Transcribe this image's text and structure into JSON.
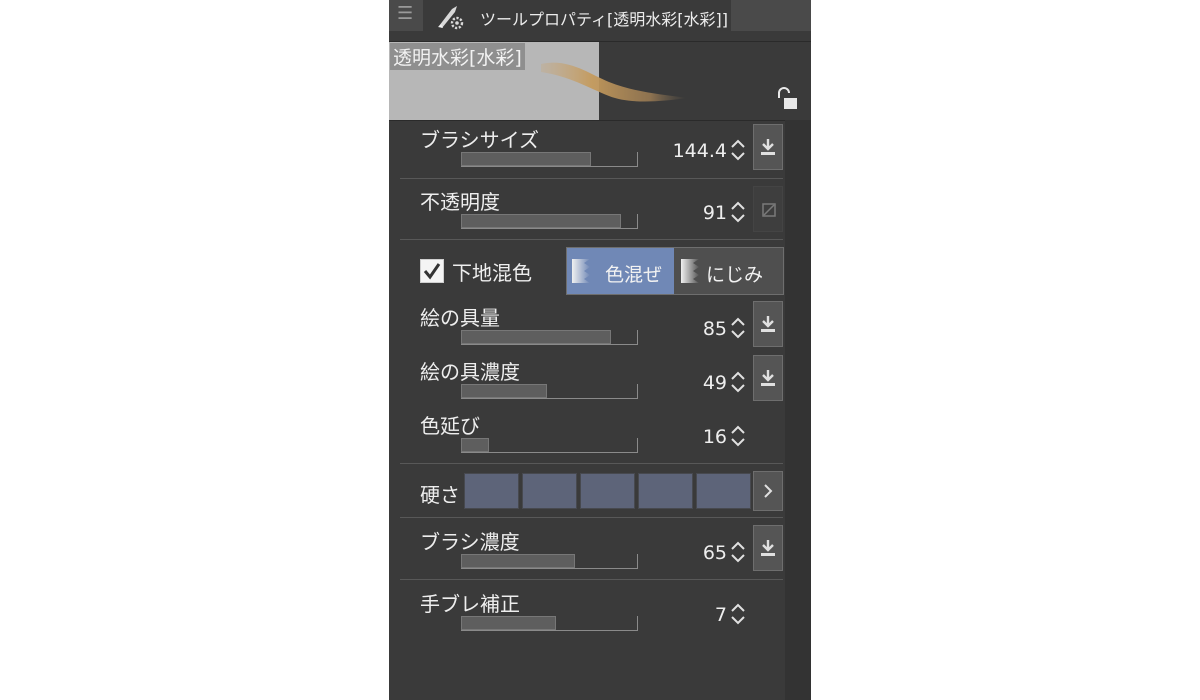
{
  "title_bar": {
    "tab_title": "ツールプロパティ[透明水彩[水彩]]"
  },
  "preview": {
    "label": "透明水彩[水彩]"
  },
  "props": {
    "brush_size": {
      "label": "ブラシサイズ",
      "value": "144.4",
      "level": 0.74
    },
    "opacity": {
      "label": "不透明度",
      "value": "91",
      "level": 0.91
    },
    "blend": {
      "label": "下地混色",
      "checked": true,
      "option1": "色混ぜ",
      "option2": "にじみ",
      "selected": "色混ぜ"
    },
    "paint_amount": {
      "label": "絵の具量",
      "value": "85",
      "level": 0.85
    },
    "paint_density": {
      "label": "絵の具濃度",
      "value": "49",
      "level": 0.49
    },
    "color_stretch": {
      "label": "色延び",
      "value": "16",
      "level": 0.16
    },
    "hardness": {
      "label": "硬さ",
      "levels": 5
    },
    "brush_density": {
      "label": "ブラシ濃度",
      "value": "65",
      "level": 0.65
    },
    "stabilization": {
      "label": "手ブレ補正",
      "value": "7",
      "level": 0.54
    }
  },
  "colors": {
    "panel_bg": "#3a3a3a",
    "accent": "#7088b6",
    "hardness_cell": "#5d6479"
  }
}
